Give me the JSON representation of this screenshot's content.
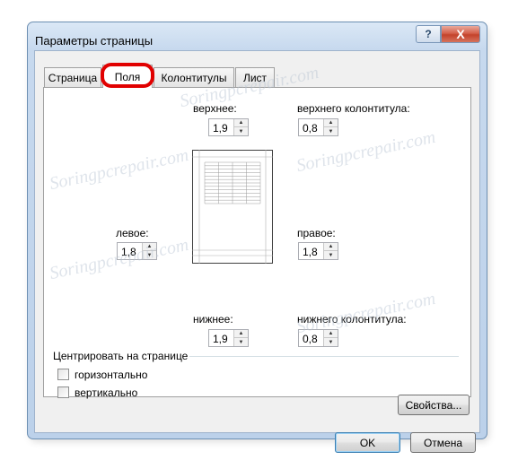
{
  "window": {
    "title": "Параметры страницы",
    "help_label": "?",
    "close_label": "X"
  },
  "tabs": [
    {
      "label": "Страница",
      "active": false
    },
    {
      "label": "Поля",
      "active": true
    },
    {
      "label": "Колонтитулы",
      "active": false
    },
    {
      "label": "Лист",
      "active": false
    }
  ],
  "margins": {
    "top": {
      "label": "верхнее:",
      "value": "1,9"
    },
    "header": {
      "label": "верхнего колонтитула:",
      "value": "0,8"
    },
    "left": {
      "label": "левое:",
      "value": "1,8"
    },
    "right": {
      "label": "правое:",
      "value": "1,8"
    },
    "bottom": {
      "label": "нижнее:",
      "value": "1,9"
    },
    "footer": {
      "label": "нижнего колонтитула:",
      "value": "0,8"
    }
  },
  "center": {
    "label": "Центрировать на странице",
    "horizontal": {
      "label": "горизонтально",
      "checked": false
    },
    "vertical": {
      "label": "вертикально",
      "checked": false
    }
  },
  "buttons": {
    "properties": "Свойства...",
    "ok": "OK",
    "cancel": "Отмена"
  },
  "watermark": "Soringpcrepair.com",
  "colors": {
    "highlight": "#e10000",
    "close_button": "#c4432b"
  }
}
